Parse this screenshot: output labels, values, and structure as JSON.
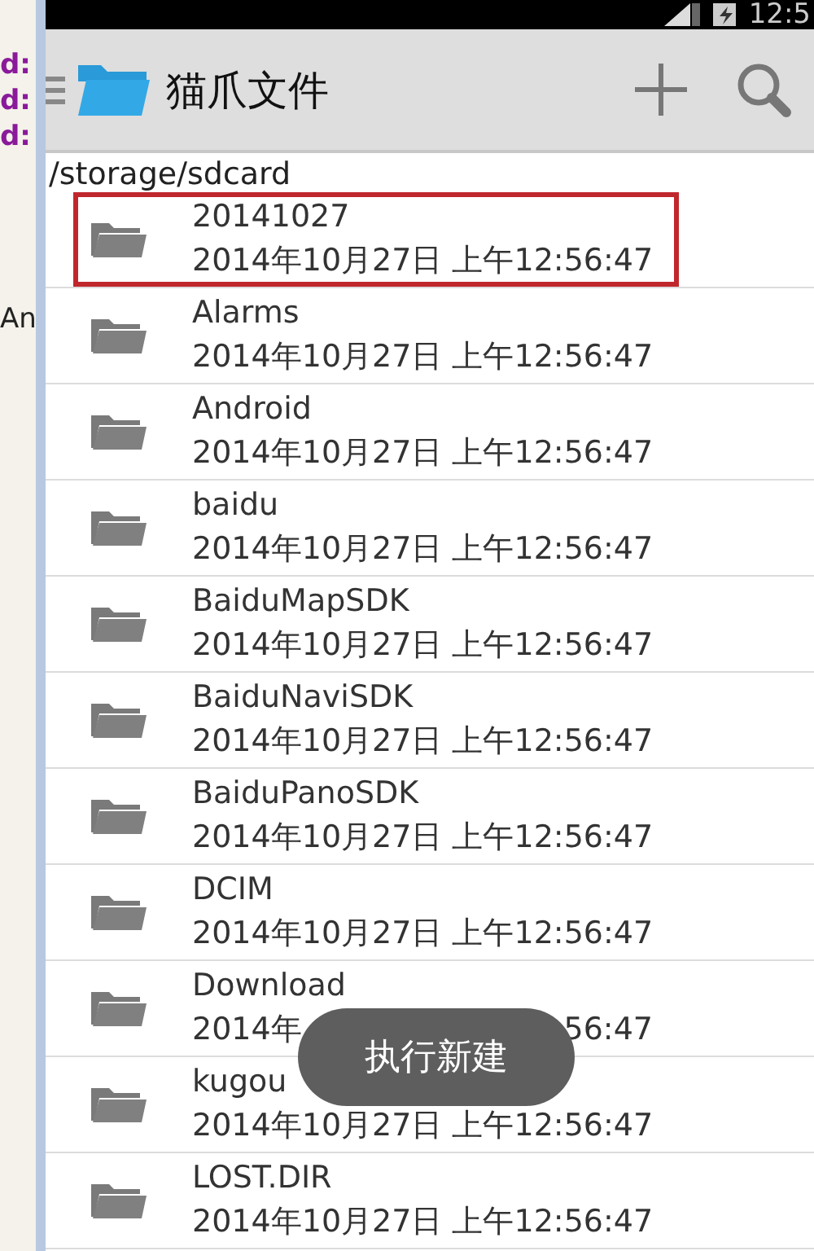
{
  "background_window": {
    "texts": [
      "d:",
      "d:",
      "d:",
      "An"
    ]
  },
  "status_bar": {
    "time": "12:5"
  },
  "action_bar": {
    "title": "猫爪文件"
  },
  "path": "/storage/sdcard",
  "files": [
    {
      "name": "20141027",
      "date": "2014年10月27日 上午12:56:47",
      "highlighted": true
    },
    {
      "name": "Alarms",
      "date": "2014年10月27日 上午12:56:47",
      "highlighted": false
    },
    {
      "name": "Android",
      "date": "2014年10月27日 上午12:56:47",
      "highlighted": false
    },
    {
      "name": "baidu",
      "date": "2014年10月27日 上午12:56:47",
      "highlighted": false
    },
    {
      "name": "BaiduMapSDK",
      "date": "2014年10月27日 上午12:56:47",
      "highlighted": false
    },
    {
      "name": "BaiduNaviSDK",
      "date": "2014年10月27日 上午12:56:47",
      "highlighted": false
    },
    {
      "name": "BaiduPanoSDK",
      "date": "2014年10月27日 上午12:56:47",
      "highlighted": false
    },
    {
      "name": "DCIM",
      "date": "2014年10月27日 上午12:56:47",
      "highlighted": false
    },
    {
      "name": "Download",
      "date": "2014年",
      "date_end": "56:47",
      "highlighted": false
    },
    {
      "name": "kugou",
      "date": "2014年10月27日 上午12:56:47",
      "highlighted": false
    },
    {
      "name": "LOST.DIR",
      "date": "2014年10月27日 上午12:56:47",
      "highlighted": false
    }
  ],
  "toast": "执行新建"
}
